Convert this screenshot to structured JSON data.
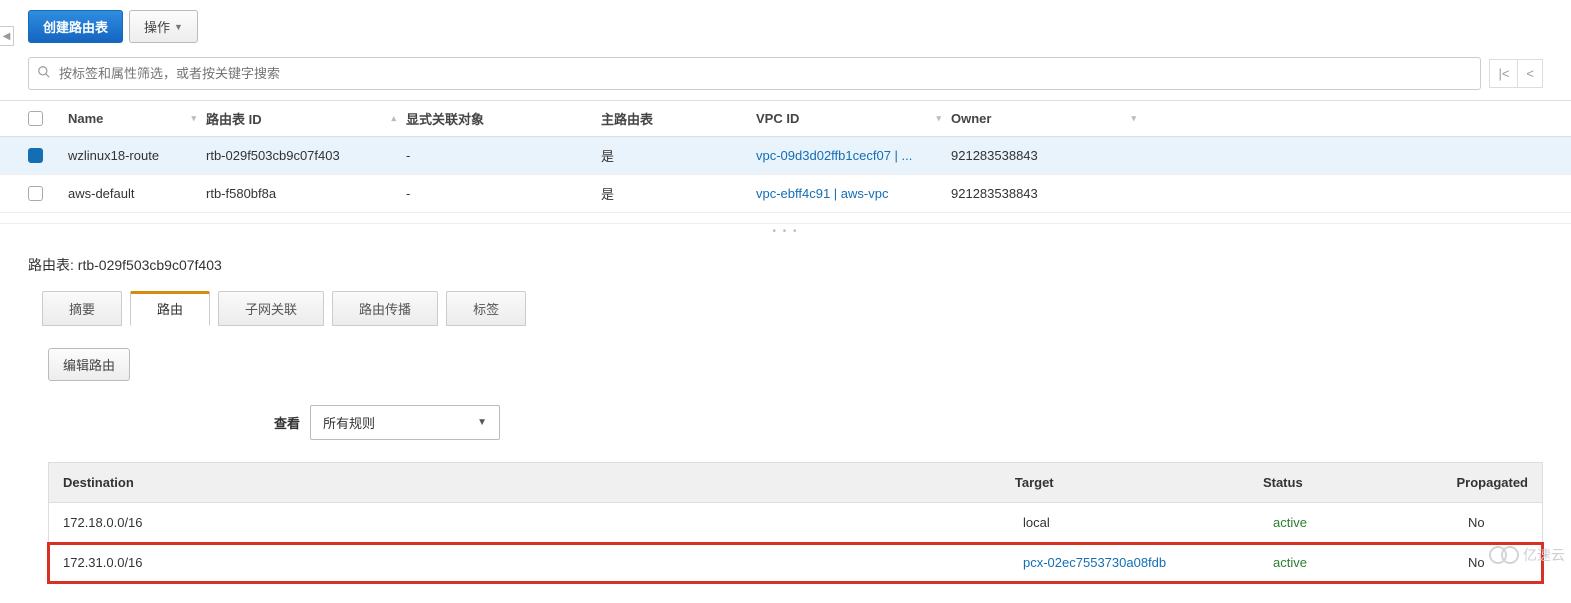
{
  "toolbar": {
    "create_label": "创建路由表",
    "actions_label": "操作"
  },
  "search": {
    "placeholder": "按标签和属性筛选，或者按关键字搜索"
  },
  "columns": {
    "name": "Name",
    "rtid": "路由表 ID",
    "assoc": "显式关联对象",
    "main": "主路由表",
    "vpc": "VPC ID",
    "owner": "Owner"
  },
  "rows": [
    {
      "selected": true,
      "name": "wzlinux18-route",
      "rtid": "rtb-029f503cb9c07f403",
      "assoc": "-",
      "main": "是",
      "vpc": "vpc-09d3d02ffb1cecf07 | ...",
      "owner": "921283538843"
    },
    {
      "selected": false,
      "name": "aws-default",
      "rtid": "rtb-f580bf8a",
      "assoc": "-",
      "main": "是",
      "vpc": "vpc-ebff4c91 | aws-vpc",
      "owner": "921283538843"
    }
  ],
  "detail": {
    "title_prefix": "路由表:",
    "title_id": "rtb-029f503cb9c07f403",
    "tabs": {
      "summary": "摘要",
      "routes": "路由",
      "subnet": "子网关联",
      "propagation": "路由传播",
      "tags": "标签"
    },
    "edit_routes_label": "编辑路由",
    "view_label": "查看",
    "view_select": "所有规则",
    "subcolumns": {
      "destination": "Destination",
      "target": "Target",
      "status": "Status",
      "propagated": "Propagated"
    },
    "routes": [
      {
        "destination": "172.18.0.0/16",
        "target": "local",
        "target_link": false,
        "status": "active",
        "propagated": "No",
        "highlight": false
      },
      {
        "destination": "172.31.0.0/16",
        "target": "pcx-02ec7553730a08fdb",
        "target_link": true,
        "status": "active",
        "propagated": "No",
        "highlight": true
      }
    ]
  },
  "watermark": "亿速云"
}
